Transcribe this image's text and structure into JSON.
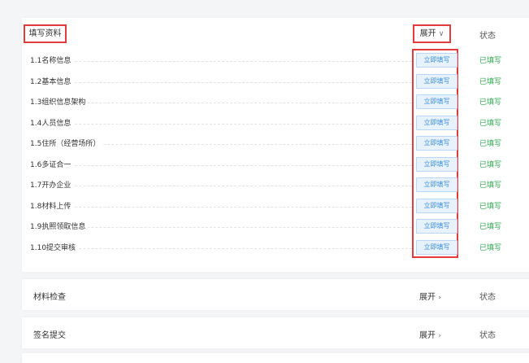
{
  "main": {
    "title": "填写资料",
    "expand_label": "展开",
    "expand_icon": "∨",
    "status_header": "状态",
    "items": [
      {
        "label": "1.1名称信息",
        "button": "立即填写",
        "status": "已填写"
      },
      {
        "label": "1.2基本信息",
        "button": "立即填写",
        "status": "已填写"
      },
      {
        "label": "1.3组织信息架构",
        "button": "立即填写",
        "status": "已填写"
      },
      {
        "label": "1.4人员信息",
        "button": "立即填写",
        "status": "已填写"
      },
      {
        "label": "1.5住所（经营场所）",
        "button": "立即填写",
        "status": "已填写"
      },
      {
        "label": "1.6多证合一",
        "button": "立即填写",
        "status": "已填写"
      },
      {
        "label": "1.7开办企业",
        "button": "立即填写",
        "status": "已填写"
      },
      {
        "label": "1.8材料上传",
        "button": "立即填写",
        "status": "已填写"
      },
      {
        "label": "1.9执照领取信息",
        "button": "立即填写",
        "status": "已填写"
      },
      {
        "label": "1.10提交审核",
        "button": "立即填写",
        "status": "已填写"
      }
    ]
  },
  "sections": [
    {
      "title": "材料检查",
      "expand_label": "展开",
      "expand_icon": "›",
      "status_header": "状态"
    },
    {
      "title": "签名提交",
      "expand_label": "展开",
      "expand_icon": "›",
      "status_header": "状态"
    }
  ],
  "colors": {
    "highlight_border": "#e23b3b",
    "button_text": "#3a8ee6",
    "button_bg": "#e8f2fd",
    "status_done": "#2fa84f"
  }
}
